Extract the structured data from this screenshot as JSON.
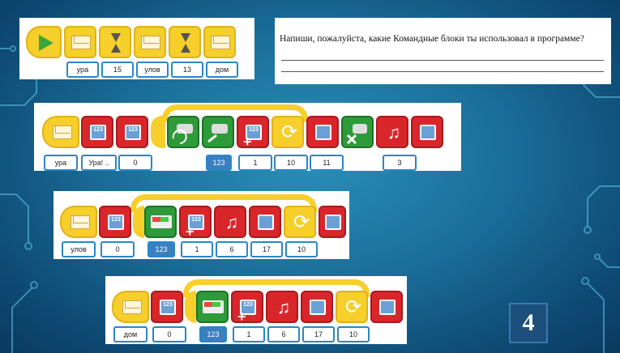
{
  "question": "Напиши, пожалуйста, какие Командные блоки ты использовал в программе?",
  "page_number": "4",
  "row1": {
    "fields": [
      "ура",
      "15",
      "улов",
      "13",
      "дом"
    ]
  },
  "row2": {
    "fields": [
      "ура",
      "Ура! ..",
      "0",
      "1",
      "10",
      "11",
      "3"
    ]
  },
  "row3": {
    "fields": [
      "улов",
      "0",
      "1",
      "6",
      "17",
      "10"
    ]
  },
  "row4": {
    "fields": [
      "дом",
      "0",
      "1",
      "6",
      "17",
      "10"
    ]
  },
  "icons": [
    "play-icon",
    "envelope-icon",
    "hourglass-icon",
    "screen-icon",
    "motor-icon",
    "loop-icon",
    "note-icon",
    "stop-icon"
  ],
  "colors": {
    "yellow": "#f6cf2a",
    "red": "#d9262b",
    "green": "#2f9a3a",
    "field_border": "#2a86c8",
    "background": "#1a6f9a"
  }
}
